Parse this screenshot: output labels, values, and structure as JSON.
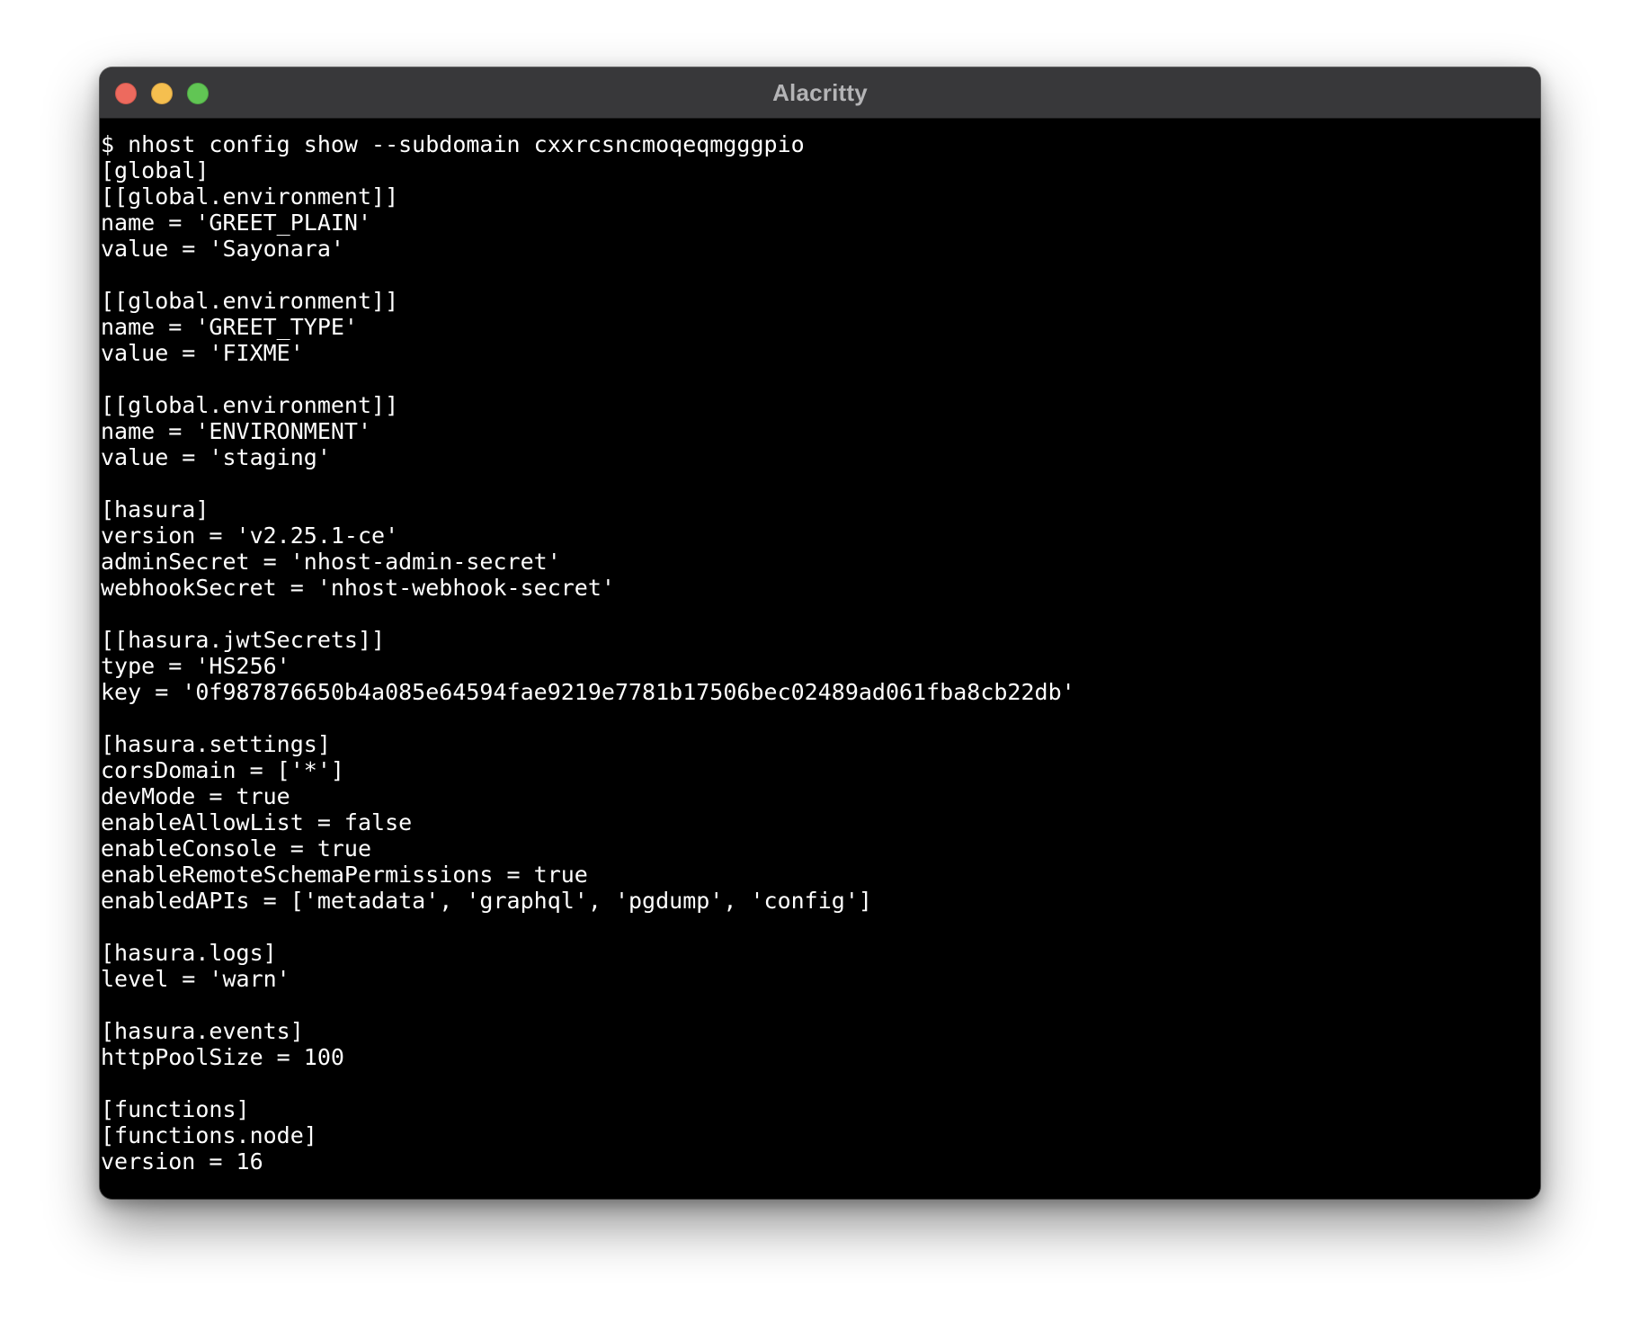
{
  "window": {
    "title": "Alacritty"
  },
  "terminal": {
    "lines": [
      "$ nhost config show --subdomain cxxrcsncmoqeqmgggpio",
      "[global]",
      "[[global.environment]]",
      "name = 'GREET_PLAIN'",
      "value = 'Sayonara'",
      "",
      "[[global.environment]]",
      "name = 'GREET_TYPE'",
      "value = 'FIXME'",
      "",
      "[[global.environment]]",
      "name = 'ENVIRONMENT'",
      "value = 'staging'",
      "",
      "[hasura]",
      "version = 'v2.25.1-ce'",
      "adminSecret = 'nhost-admin-secret'",
      "webhookSecret = 'nhost-webhook-secret'",
      "",
      "[[hasura.jwtSecrets]]",
      "type = 'HS256'",
      "key = '0f987876650b4a085e64594fae9219e7781b17506bec02489ad061fba8cb22db'",
      "",
      "[hasura.settings]",
      "corsDomain = ['*']",
      "devMode = true",
      "enableAllowList = false",
      "enableConsole = true",
      "enableRemoteSchemaPermissions = true",
      "enabledAPIs = ['metadata', 'graphql', 'pgdump', 'config']",
      "",
      "[hasura.logs]",
      "level = 'warn'",
      "",
      "[hasura.events]",
      "httpPoolSize = 100",
      "",
      "[functions]",
      "[functions.node]",
      "version = 16"
    ]
  },
  "colors": {
    "titlebar": "#38383a",
    "title_text": "#b4b4b6",
    "terminal_bg": "#000000",
    "terminal_fg": "#ffffff",
    "close": "#ed6a5e",
    "minimize": "#f5bf4f",
    "zoom": "#61c554"
  },
  "icons": [
    "close-icon",
    "minimize-icon",
    "zoom-icon"
  ]
}
